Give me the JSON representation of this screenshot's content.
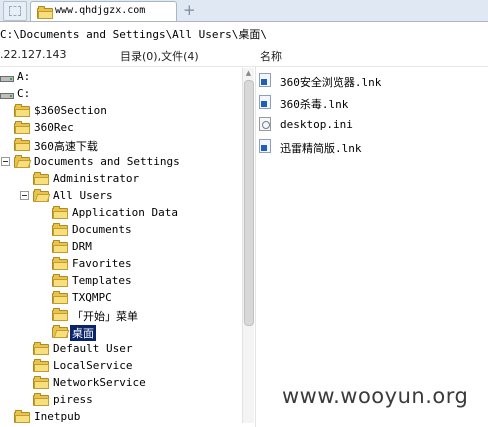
{
  "tabs": [
    {
      "label": "www.qhdjgzx.com"
    }
  ],
  "new_tab_label": "+",
  "address": {
    "path": "C:\\Documents and Settings\\All Users\\桌面\\"
  },
  "header": {
    "ip": ".22.127.143",
    "counts": "目录(0),文件(4)",
    "name_column": "名称"
  },
  "tree": [
    {
      "label": "A:",
      "icon": "drive-icon"
    },
    {
      "label": "C:",
      "icon": "drive-icon"
    },
    {
      "label": "$360Section",
      "icon": "folder-icon"
    },
    {
      "label": "360Rec",
      "icon": "folder-icon"
    },
    {
      "label": "360高速下载",
      "icon": "folder-icon"
    },
    {
      "label": "Documents and Settings",
      "icon": "folder-open-icon"
    },
    {
      "label": "Administrator",
      "icon": "folder-icon"
    },
    {
      "label": "All Users",
      "icon": "folder-open-icon"
    },
    {
      "label": "Application Data",
      "icon": "folder-icon"
    },
    {
      "label": "Documents",
      "icon": "folder-icon"
    },
    {
      "label": "DRM",
      "icon": "folder-icon"
    },
    {
      "label": "Favorites",
      "icon": "folder-icon"
    },
    {
      "label": "Templates",
      "icon": "folder-icon"
    },
    {
      "label": "TXQMPC",
      "icon": "folder-icon"
    },
    {
      "label": "「开始」菜单",
      "icon": "folder-icon"
    },
    {
      "label": "桌面",
      "icon": "folder-open-icon"
    },
    {
      "label": "Default User",
      "icon": "folder-icon"
    },
    {
      "label": "LocalService",
      "icon": "folder-icon"
    },
    {
      "label": "NetworkService",
      "icon": "folder-icon"
    },
    {
      "label": "piress",
      "icon": "folder-icon"
    },
    {
      "label": "Inetpub",
      "icon": "folder-icon"
    }
  ],
  "files": [
    {
      "label": "360安全浏览器.lnk",
      "icon": "shortcut-icon"
    },
    {
      "label": "360杀毒.lnk",
      "icon": "shortcut-icon"
    },
    {
      "label": "desktop.ini",
      "icon": "ini-file-icon"
    },
    {
      "label": "迅雷精简版.lnk",
      "icon": "shortcut-icon"
    }
  ],
  "watermark": "www.wooyun.org",
  "colors": {
    "selection": "#0a246a",
    "folder": "#e9c34d",
    "tabstrip": "#dfe8f3"
  }
}
